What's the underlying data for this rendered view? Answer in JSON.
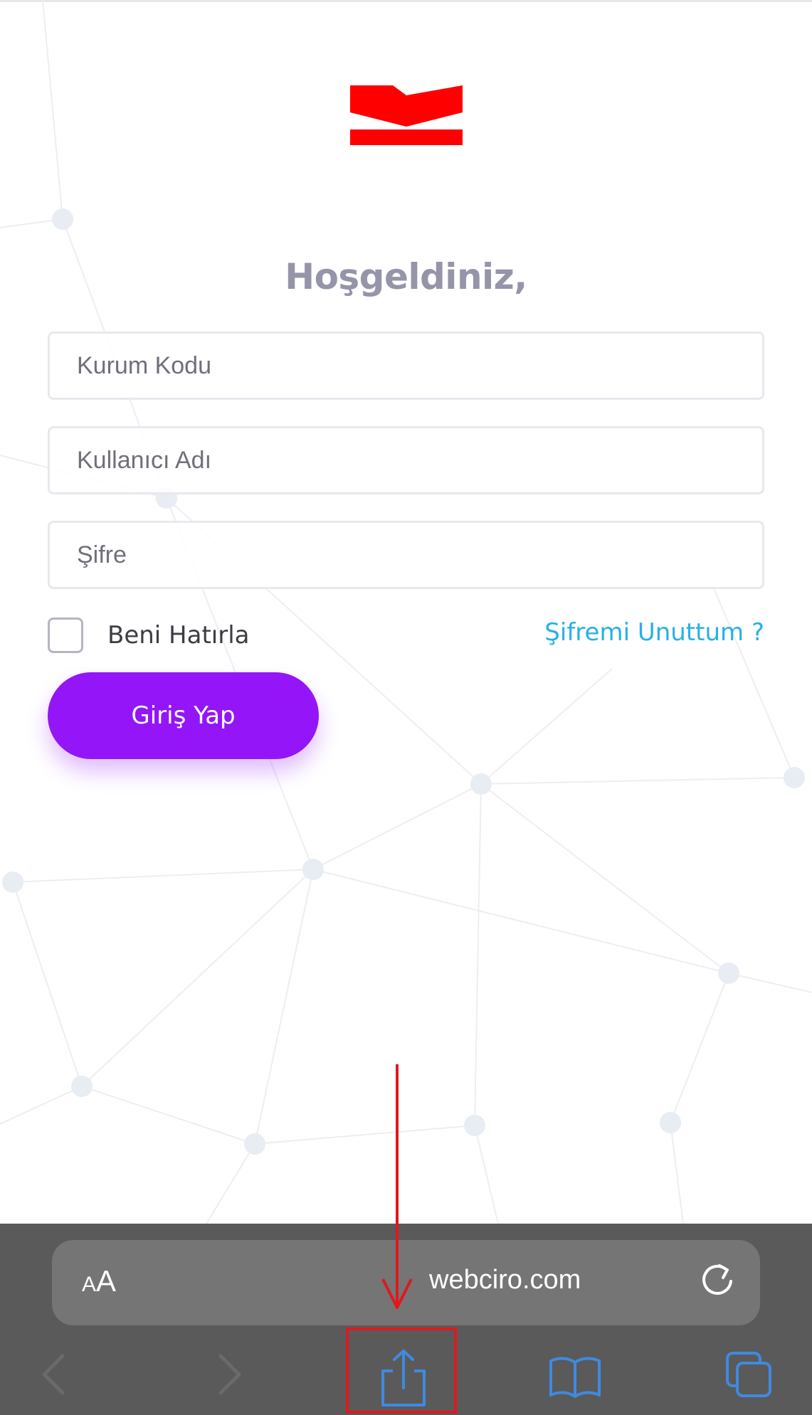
{
  "header": {
    "welcome_title": "Hoşgeldiniz,"
  },
  "form": {
    "institution_code_placeholder": "Kurum Kodu",
    "institution_code_value": "",
    "username_placeholder": "Kullanıcı Adı",
    "username_value": "",
    "password_placeholder": "Şifre",
    "password_value": "",
    "remember_label": "Beni Hatırla",
    "remember_checked": false,
    "forgot_link": "Şifremi Unuttum ?",
    "login_button": "Giriş Yap"
  },
  "browser": {
    "text_size_label_small": "A",
    "text_size_label_large": "A",
    "domain": "webciro.com",
    "icons": [
      "reload-icon",
      "back-icon",
      "forward-icon",
      "share-icon",
      "bookmarks-icon",
      "tabs-icon"
    ]
  },
  "colors": {
    "accent_purple": "#9415f7",
    "link_blue": "#29b0e6",
    "logo_red": "#ff0000",
    "toolbar_icon_blue": "#3f8ae0",
    "annotation_red": "#e0181e"
  }
}
